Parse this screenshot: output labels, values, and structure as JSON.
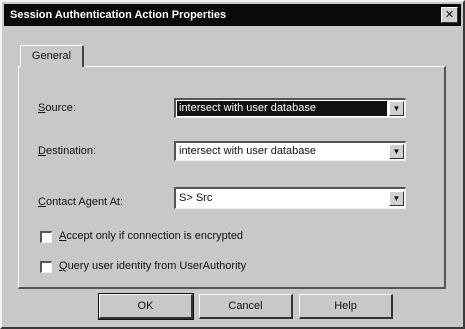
{
  "window": {
    "title": "Session Authentication Action Properties",
    "close_label": "✕"
  },
  "tabs": [
    {
      "label": "General"
    }
  ],
  "fields": {
    "source": {
      "label_accel": "S",
      "label_rest": "ource:",
      "value": "intersect with user database"
    },
    "destination": {
      "label_accel": "D",
      "label_rest": "estination:",
      "value": "intersect with user database"
    },
    "contact_agent": {
      "label_accel": "C",
      "label_rest": "ontact Agent At:",
      "value": "S> Src"
    }
  },
  "checkboxes": [
    {
      "label_accel": "A",
      "label_rest": "ccept only if connection is encrypted",
      "checked": false
    },
    {
      "label_accel": "Q",
      "label_rest": "uery user identity from UserAuthority",
      "checked": false
    }
  ],
  "buttons": {
    "ok": "OK",
    "cancel": "Cancel",
    "help": "Help"
  },
  "icons": {
    "combo_arrow": "▼"
  }
}
